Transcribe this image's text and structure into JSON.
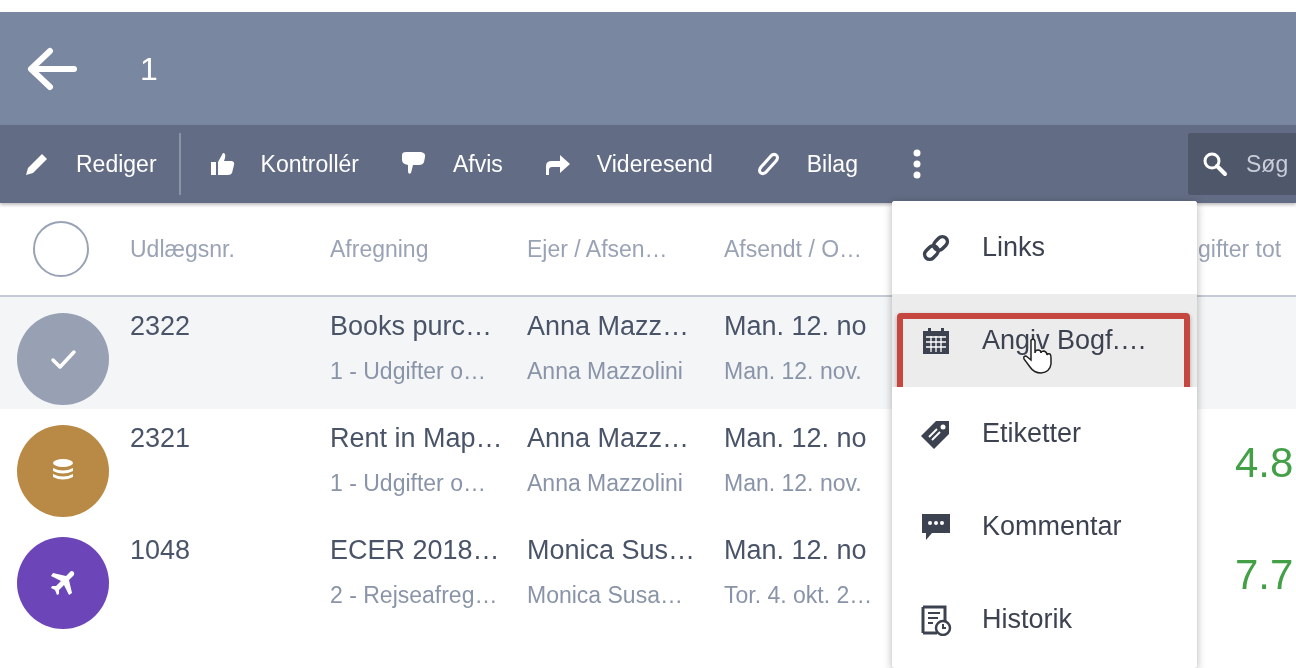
{
  "header": {
    "title": "1"
  },
  "toolbar": {
    "actions": [
      {
        "label": "Rediger",
        "kind": "pencil"
      },
      {
        "label": "Kontrollér",
        "kind": "thumbsup"
      },
      {
        "label": "Afvis",
        "kind": "thumbsdown"
      },
      {
        "label": "Videresend",
        "kind": "forward"
      },
      {
        "label": "Bilag",
        "kind": "paperclip"
      }
    ],
    "search": {
      "placeholder": "Søg"
    }
  },
  "table": {
    "select_all_checked": false,
    "columns": [
      "Udlægsnr.",
      "Afregning",
      "Ejer / Afsen…",
      "Afsendt / O…",
      "gifter tot"
    ],
    "rows": [
      {
        "selected": true,
        "color": "#98a1b4",
        "number": "2322",
        "settlement": "Books purc…",
        "settlement_sub": "1 - Udgifter o…",
        "owner": "Anna Mazz…",
        "owner_sub": "Anna Mazzolini",
        "sent": "Man. 12. no",
        "sent_sub": "Man. 12. nov.",
        "amount": ""
      },
      {
        "selected": false,
        "kind": "expense",
        "color": "#b98a45",
        "number": "2321",
        "settlement": "Rent in Map…",
        "settlement_sub": "1 - Udgifter o…",
        "owner": "Anna Mazz…",
        "owner_sub": "Anna Mazzolini",
        "sent": "Man. 12. no",
        "sent_sub": "Man. 12. nov.",
        "amount": "4.8"
      },
      {
        "selected": false,
        "kind": "travel",
        "color": "#6c45b8",
        "number": "1048",
        "settlement": "ECER 2018…",
        "settlement_sub": "2 - Rejseafreg…",
        "owner": "Monica Sus…",
        "owner_sub": "Monica Susa…",
        "sent": "Man. 12. no",
        "sent_sub": "Tor. 4. okt. 2…",
        "amount": "7.7"
      }
    ]
  },
  "menu": {
    "items": [
      {
        "label": "Links",
        "kind": "link",
        "hovered": false,
        "highlighted": false,
        "cursor": false
      },
      {
        "label": "Angiv Bogf.…",
        "kind": "calendar",
        "hovered": true,
        "highlighted": true,
        "cursor": true
      },
      {
        "label": "Etiketter",
        "kind": "tag",
        "hovered": false,
        "highlighted": false,
        "cursor": false
      },
      {
        "label": "Kommentar",
        "kind": "comment",
        "hovered": false,
        "highlighted": false,
        "cursor": false
      },
      {
        "label": "Historik",
        "kind": "history",
        "hovered": false,
        "highlighted": false,
        "cursor": false
      }
    ]
  }
}
